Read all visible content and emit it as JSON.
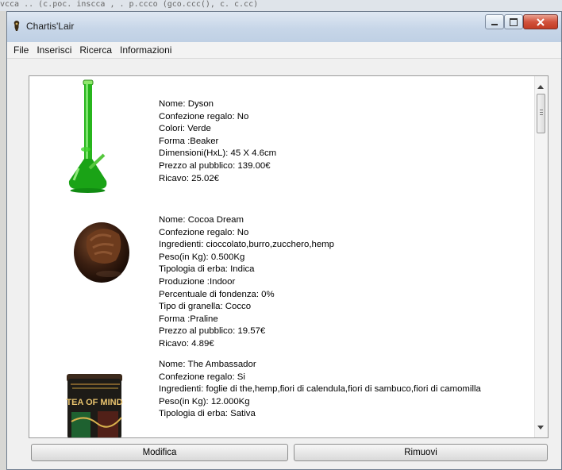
{
  "background_text": "vcca .. (c.poc.  inscca        ,  . p.ccco   (gco.ccc(), c. c.cc)",
  "window": {
    "title": "Chartis'Lair"
  },
  "menu": {
    "items": [
      "File",
      "Inserisci",
      "Ricerca",
      "Informazioni"
    ]
  },
  "products": [
    {
      "image_icon": "green-glass-bong",
      "details": [
        "Nome: Dyson",
        "Confezione regalo: No",
        "Colori: Verde",
        "Forma :Beaker",
        "Dimensioni(HxL): 45 X 4.6cm",
        "Prezzo al pubblico: 139.00€",
        "Ricavo: 25.02€"
      ]
    },
    {
      "image_icon": "chocolate-praline",
      "details": [
        "Nome: Cocoa Dream",
        "Confezione regalo: No",
        "Ingredienti: cioccolato,burro,zucchero,hemp",
        "Peso(in Kg): 0.500Kg",
        "Tipologia di erba: Indica",
        "Produzione :Indoor",
        "Percentuale di fondenza: 0%",
        "Tipo di granella: Cocco",
        "Forma :Praline",
        "Prezzo al pubblico: 19.57€",
        "Ricavo: 4.89€"
      ]
    },
    {
      "image_icon": "tea-tin",
      "image_text": "TEA OF MIND",
      "details": [
        "Nome: The Ambassador",
        "Confezione regalo: Si",
        "Ingredienti: foglie di the,hemp,fiori di calendula,fiori di sambuco,fiori di camomilla",
        "Peso(in Kg): 12.000Kg",
        "Tipologia di erba: Sativa"
      ]
    }
  ],
  "buttons": {
    "modify": "Modifica",
    "remove": "Rimuovi"
  }
}
